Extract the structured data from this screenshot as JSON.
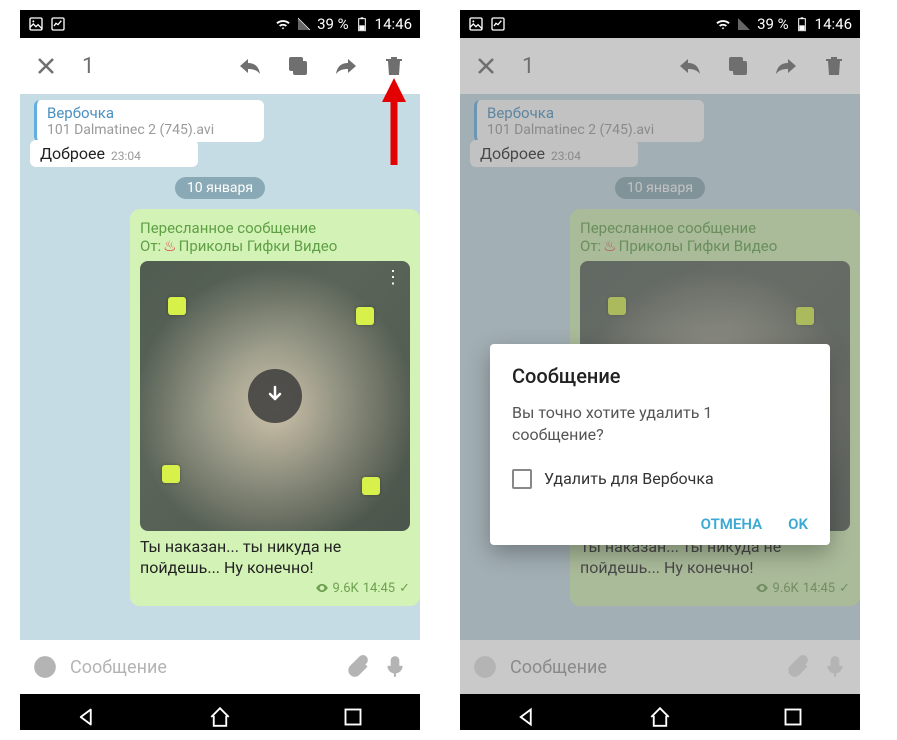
{
  "status": {
    "battery": "39 %",
    "time": "14:46"
  },
  "actionbar": {
    "count": "1"
  },
  "chat": {
    "reply_name": "Вербочка",
    "reply_sub": "101 Dalmatinec 2 (745).avi",
    "out_text": "Доброее",
    "out_time": "23:04",
    "date": "10 января",
    "fwd_label": "Пересланное сообщение",
    "fwd_from_prefix": "От: ",
    "fwd_from_name": "Приколы Гифки Видео",
    "caption": "Ты наказан... ты никуда не пойдешь... Ну конечно!",
    "views": "9.6K",
    "msg_time": "14:45"
  },
  "input": {
    "placeholder": "Сообщение"
  },
  "dialog": {
    "title": "Сообщение",
    "text": "Вы точно хотите удалить 1 сообщение?",
    "checkbox_label": "Удалить для Вербочка",
    "cancel": "ОТМЕНА",
    "ok": "OK"
  }
}
